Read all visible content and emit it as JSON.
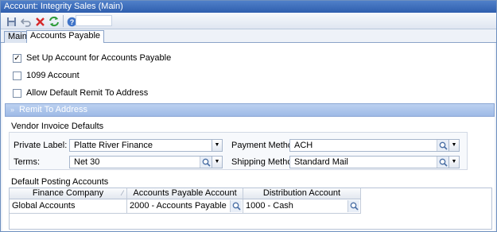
{
  "window": {
    "title": "Account: Integrity Sales (Main)"
  },
  "toolbar": {
    "save_icon": "save-icon",
    "undo_icon": "undo-icon",
    "delete_icon": "delete-icon",
    "refresh_icon": "refresh-icon",
    "help_icon": "help-icon"
  },
  "tabs": [
    {
      "label": "Main"
    },
    {
      "label": "Accounts Payable"
    }
  ],
  "checkboxes": [
    {
      "label": "Set Up Account for Accounts Payable",
      "checked": true
    },
    {
      "label": "1099 Account",
      "checked": false
    },
    {
      "label": "Allow Default Remit To Address",
      "checked": false
    }
  ],
  "remit_section": {
    "label": "Remit To Address"
  },
  "vendor_defaults": {
    "title": "Vendor Invoice Defaults",
    "private_label_label": "Private Label:",
    "private_label_value": "Platte River Finance",
    "terms_label": "Terms:",
    "terms_value": "Net 30",
    "payment_method_label": "Payment Method:",
    "payment_method_value": "ACH",
    "shipping_method_label": "Shipping Method:",
    "shipping_method_value": "Standard Mail"
  },
  "posting": {
    "title": "Default Posting Accounts",
    "columns": [
      "Finance Company",
      "Accounts Payable Account",
      "Distribution Account"
    ],
    "rows": [
      [
        "Global Accounts",
        "2000 - Accounts Payable",
        "1000 - Cash"
      ]
    ]
  },
  "colors": {
    "titlebar": "#3a6cbc",
    "section_band": "#a9c2ea",
    "delete_red": "#d62828",
    "refresh_green": "#2e9c3a"
  }
}
